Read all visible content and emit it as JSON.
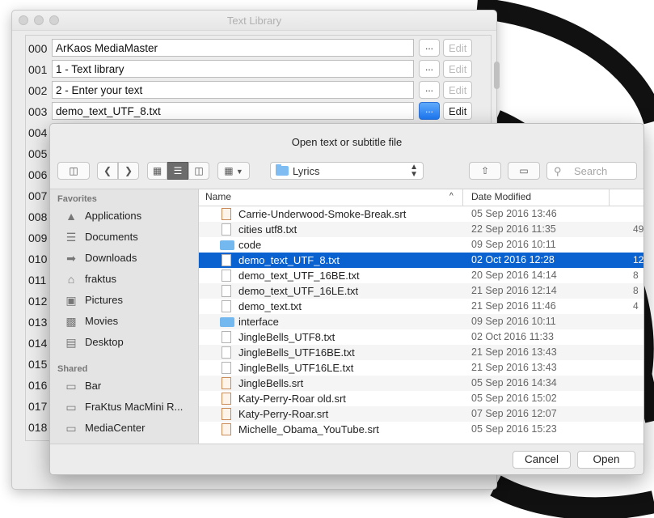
{
  "library": {
    "title": "Text Library",
    "rows": [
      {
        "num": "000",
        "text": "ArKaos MediaMaster",
        "dots": "...",
        "edit": "Edit",
        "selected": false
      },
      {
        "num": "001",
        "text": "1 - Text library",
        "dots": "...",
        "edit": "Edit",
        "selected": false
      },
      {
        "num": "002",
        "text": "2 - Enter your text",
        "dots": "...",
        "edit": "Edit",
        "selected": false
      },
      {
        "num": "003",
        "text": "demo_text_UTF_8.txt",
        "dots": "...",
        "edit": "Edit",
        "selected": true
      },
      {
        "num": "004"
      },
      {
        "num": "005"
      },
      {
        "num": "006"
      },
      {
        "num": "007"
      },
      {
        "num": "008"
      },
      {
        "num": "009"
      },
      {
        "num": "010"
      },
      {
        "num": "011"
      },
      {
        "num": "012"
      },
      {
        "num": "013"
      },
      {
        "num": "014"
      },
      {
        "num": "015"
      },
      {
        "num": "016"
      },
      {
        "num": "017"
      },
      {
        "num": "018"
      }
    ]
  },
  "dialog": {
    "title": "Open text or subtitle file",
    "location": "Lyrics",
    "search_placeholder": "Search",
    "columns": {
      "name": "Name",
      "date": "Date Modified"
    },
    "sidebar": {
      "favorites_header": "Favorites",
      "favorites": [
        {
          "label": "Applications",
          "icon": "applications-icon"
        },
        {
          "label": "Documents",
          "icon": "documents-icon"
        },
        {
          "label": "Downloads",
          "icon": "downloads-icon"
        },
        {
          "label": "fraktus",
          "icon": "home-icon"
        },
        {
          "label": "Pictures",
          "icon": "pictures-icon"
        },
        {
          "label": "Movies",
          "icon": "movies-icon"
        },
        {
          "label": "Desktop",
          "icon": "desktop-icon"
        }
      ],
      "shared_header": "Shared",
      "shared": [
        {
          "label": "Bar",
          "icon": "server-icon"
        },
        {
          "label": "FraKtus MacMini R...",
          "icon": "server-icon"
        },
        {
          "label": "MediaCenter",
          "icon": "server-icon"
        }
      ]
    },
    "files": [
      {
        "name": "Carrie-Underwood-Smoke-Break.srt",
        "date": "05 Sep 2016 13:46",
        "size": "",
        "kind": "srt"
      },
      {
        "name": "cities utf8.txt",
        "date": "22 Sep 2016 11:35",
        "size": "49",
        "kind": "txt"
      },
      {
        "name": "code",
        "date": "09 Sep 2016 10:11",
        "size": "",
        "kind": "folder"
      },
      {
        "name": "demo_text_UTF_8.txt",
        "date": "02 Oct 2016 12:28",
        "size": "12",
        "kind": "txt",
        "selected": true
      },
      {
        "name": "demo_text_UTF_16BE.txt",
        "date": "20 Sep 2016 14:14",
        "size": "8",
        "kind": "txt"
      },
      {
        "name": "demo_text_UTF_16LE.txt",
        "date": "21 Sep 2016 12:14",
        "size": "8",
        "kind": "txt"
      },
      {
        "name": "demo_text.txt",
        "date": "21 Sep 2016 11:46",
        "size": "4",
        "kind": "txt"
      },
      {
        "name": "interface",
        "date": "09 Sep 2016 10:11",
        "size": "",
        "kind": "folder"
      },
      {
        "name": "JingleBells_UTF8.txt",
        "date": "02 Oct 2016 11:33",
        "size": "",
        "kind": "txt"
      },
      {
        "name": "JingleBells_UTF16BE.txt",
        "date": "21 Sep 2016 13:43",
        "size": "",
        "kind": "txt"
      },
      {
        "name": "JingleBells_UTF16LE.txt",
        "date": "21 Sep 2016 13:43",
        "size": "",
        "kind": "txt"
      },
      {
        "name": "JingleBells.srt",
        "date": "05 Sep 2016 14:34",
        "size": "",
        "kind": "srt"
      },
      {
        "name": "Katy-Perry-Roar old.srt",
        "date": "05 Sep 2016 15:02",
        "size": "",
        "kind": "srt"
      },
      {
        "name": "Katy-Perry-Roar.srt",
        "date": "07 Sep 2016 12:07",
        "size": "",
        "kind": "srt"
      },
      {
        "name": "Michelle_Obama_YouTube.srt",
        "date": "05 Sep 2016 15:23",
        "size": "",
        "kind": "srt"
      }
    ],
    "cancel_label": "Cancel",
    "open_label": "Open"
  },
  "colors": {
    "selection": "#0a62d0",
    "accent_button": "#1e7af6",
    "folder": "#74b8f0"
  }
}
